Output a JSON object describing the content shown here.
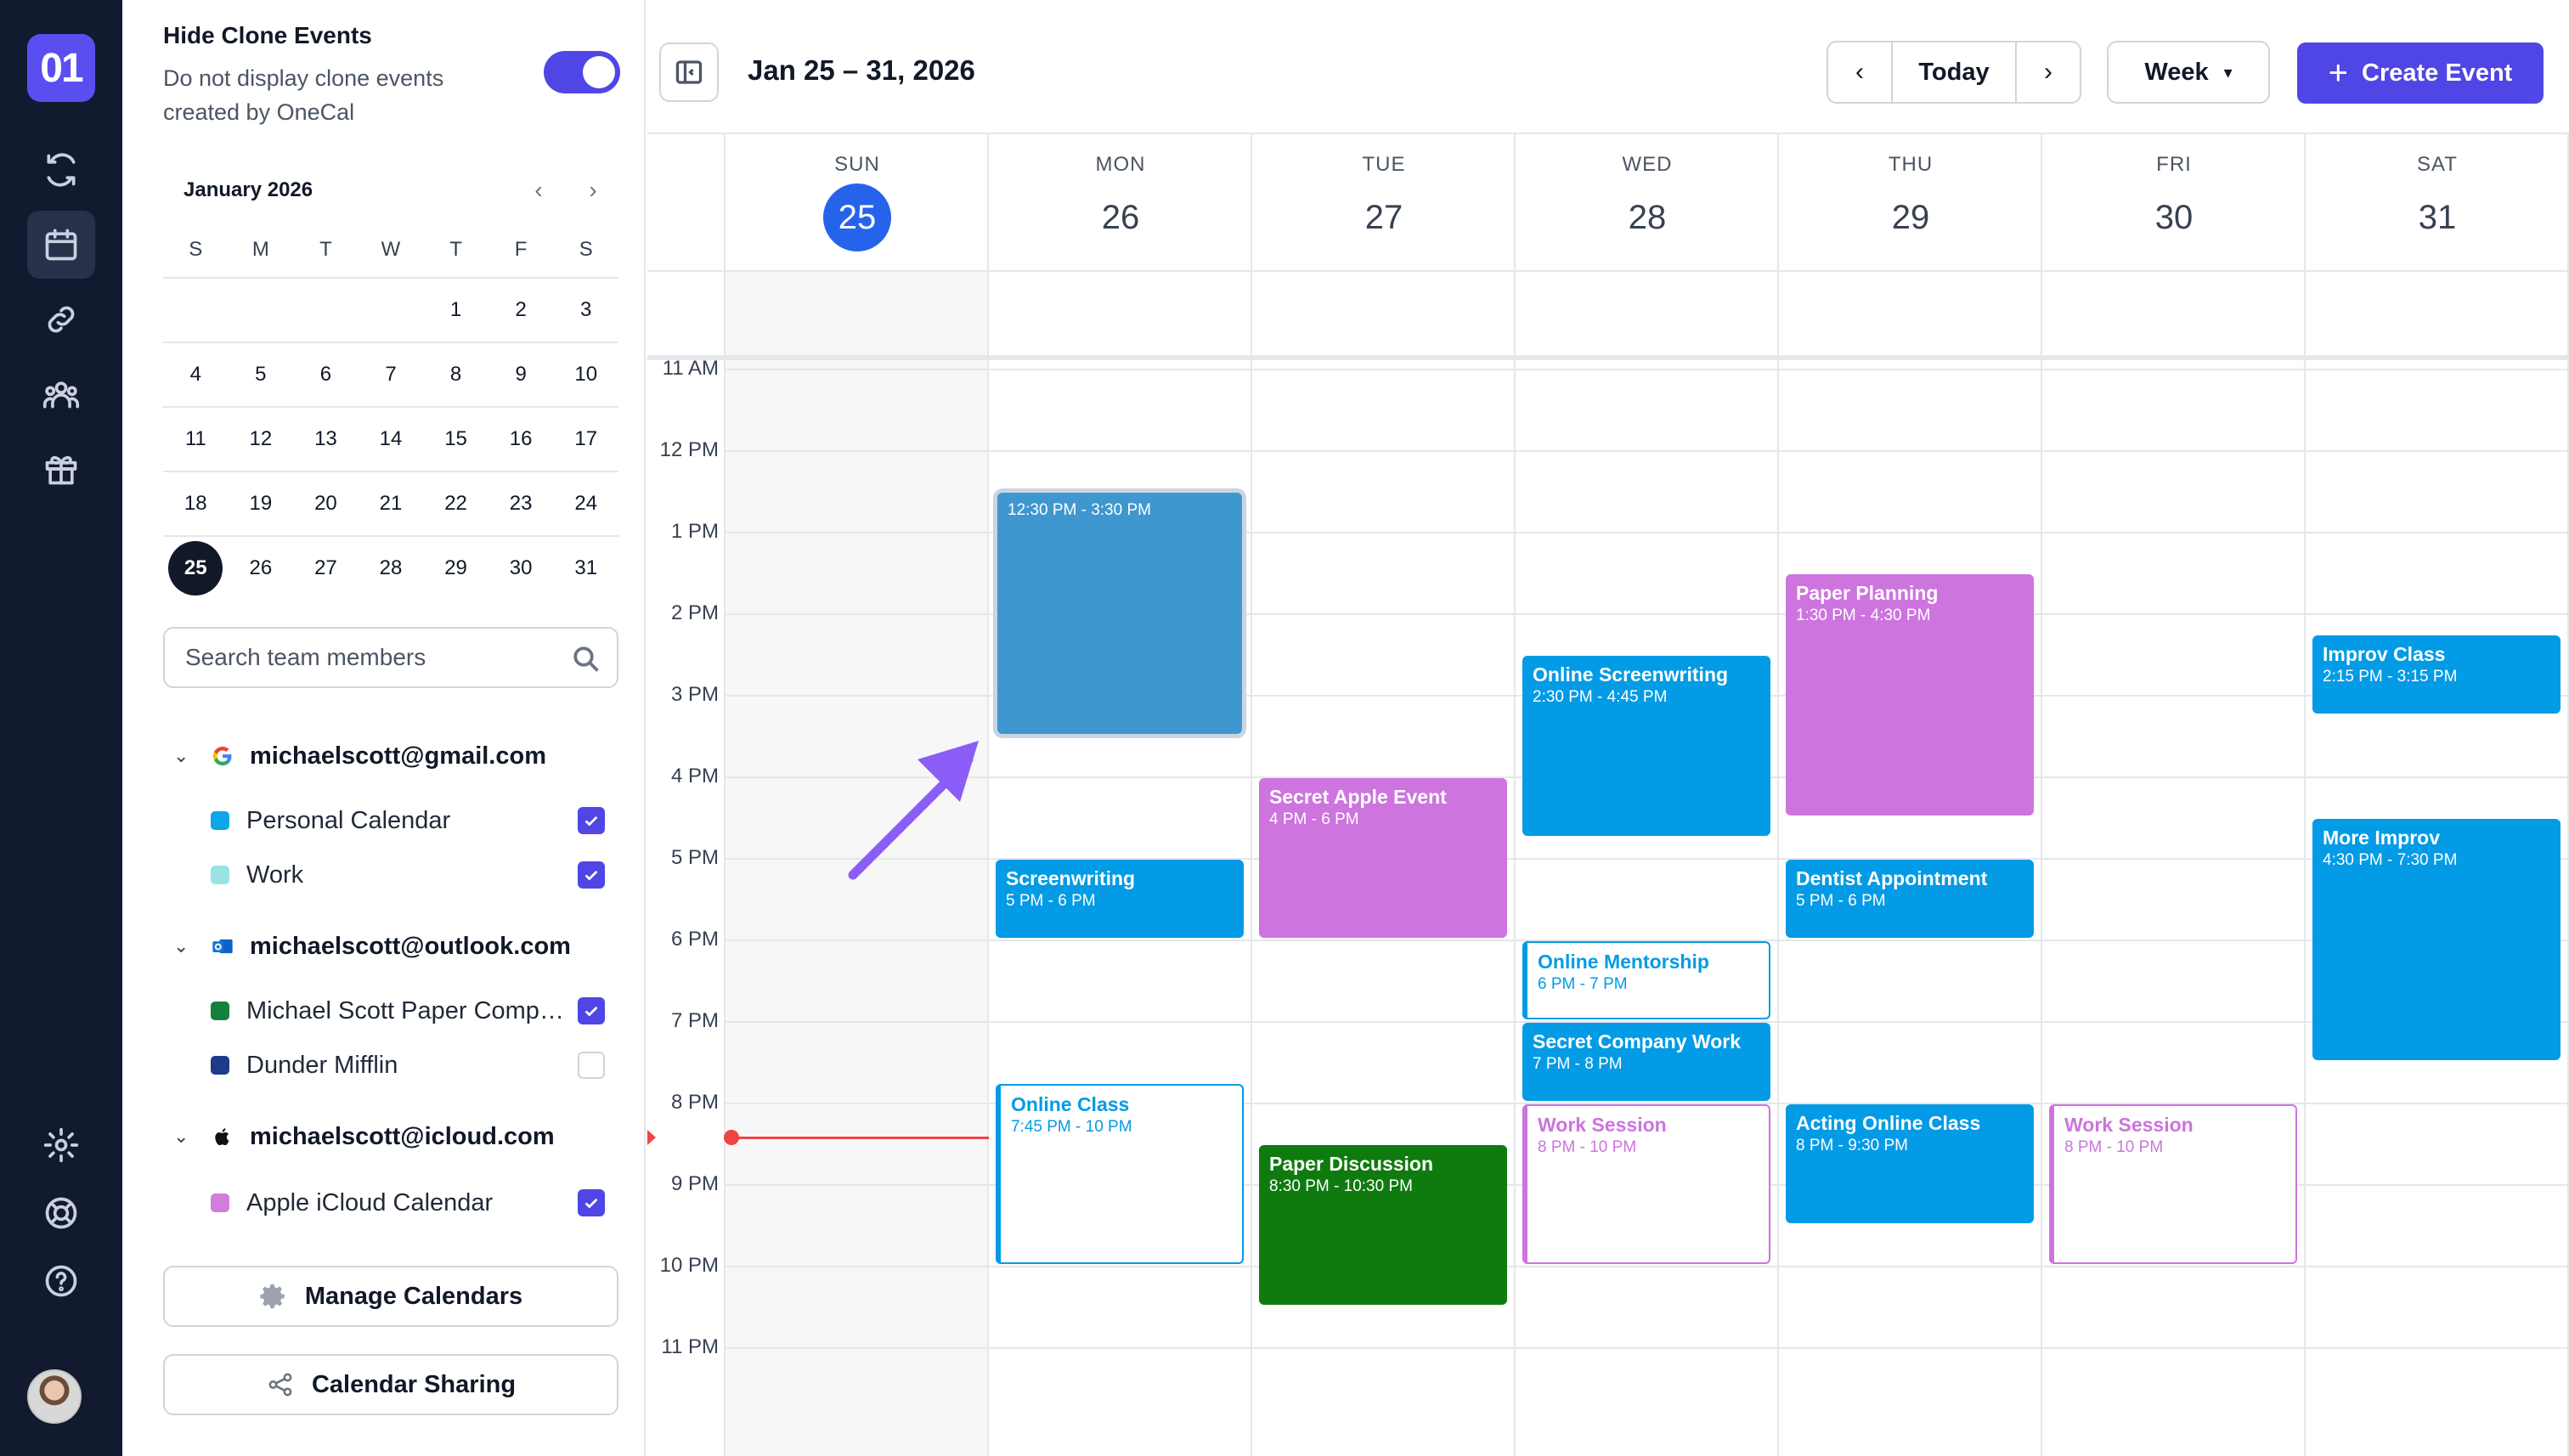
{
  "app": {
    "logo_text": "01"
  },
  "clone": {
    "title": "Hide Clone Events",
    "description": "Do not display clone events created by OneCal",
    "enabled": true
  },
  "mini_calendar": {
    "month_label": "January 2026",
    "weekdays": [
      "S",
      "M",
      "T",
      "W",
      "T",
      "F",
      "S"
    ],
    "weeks": [
      [
        "",
        "",
        "",
        "",
        "1",
        "2",
        "3"
      ],
      [
        "4",
        "5",
        "6",
        "7",
        "8",
        "9",
        "10"
      ],
      [
        "11",
        "12",
        "13",
        "14",
        "15",
        "16",
        "17"
      ],
      [
        "18",
        "19",
        "20",
        "21",
        "22",
        "23",
        "24"
      ],
      [
        "25",
        "26",
        "27",
        "28",
        "29",
        "30",
        "31"
      ]
    ],
    "selected": "25"
  },
  "search": {
    "placeholder": "Search team members"
  },
  "accounts": [
    {
      "email": "michaelscott@gmail.com",
      "provider": "google-icon",
      "calendars": [
        {
          "name": "Personal Calendar",
          "color": "#0ea5e9",
          "checked": true
        },
        {
          "name": "Work",
          "color": "#99e3e3",
          "checked": true
        }
      ]
    },
    {
      "email": "michaelscott@outlook.com",
      "provider": "outlook-icon",
      "calendars": [
        {
          "name": "Michael Scott Paper Company",
          "color": "#15803d",
          "checked": true
        },
        {
          "name": "Dunder Mifflin",
          "color": "#1e3a8a",
          "checked": false
        }
      ]
    },
    {
      "email": "michaelscott@icloud.com",
      "provider": "apple-icon",
      "calendars": [
        {
          "name": "Apple iCloud Calendar",
          "color": "#d17ddb",
          "checked": true
        }
      ]
    }
  ],
  "buttons": {
    "manage": "Manage Calendars",
    "sharing": "Calendar Sharing"
  },
  "header": {
    "range": "Jan 25 – 31, 2026",
    "today": "Today",
    "view": "Week",
    "create": "Create Event"
  },
  "days": [
    {
      "dow": "SUN",
      "num": "25",
      "today": true
    },
    {
      "dow": "MON",
      "num": "26"
    },
    {
      "dow": "TUE",
      "num": "27"
    },
    {
      "dow": "WED",
      "num": "28"
    },
    {
      "dow": "THU",
      "num": "29"
    },
    {
      "dow": "FRI",
      "num": "30"
    },
    {
      "dow": "SAT",
      "num": "31"
    }
  ],
  "hours": [
    "11 AM",
    "12 PM",
    "1 PM",
    "2 PM",
    "3 PM",
    "4 PM",
    "5 PM",
    "6 PM",
    "7 PM",
    "8 PM",
    "9 PM",
    "10 PM",
    "11 PM"
  ],
  "first_hour": 11,
  "now_hour": 20.42,
  "events": [
    {
      "day": 1,
      "start": 12.5,
      "end": 15.5,
      "title": "",
      "time": "12:30 PM - 3:30 PM",
      "style": "selected",
      "color": "#3f97cf"
    },
    {
      "day": 1,
      "start": 17,
      "end": 18,
      "title": "Screenwriting",
      "time": "5 PM - 6 PM",
      "style": "solid",
      "color": "#039be5"
    },
    {
      "day": 1,
      "start": 19.75,
      "end": 22,
      "title": "Online Class",
      "time": "7:45 PM - 10 PM",
      "style": "outline",
      "color": "#039be5"
    },
    {
      "day": 2,
      "start": 16,
      "end": 18,
      "title": "Secret Apple Event",
      "time": "4 PM - 6 PM",
      "style": "solid",
      "color": "#cd74de"
    },
    {
      "day": 2,
      "start": 20.5,
      "end": 22.5,
      "title": "Paper Discussion",
      "time": "8:30 PM - 10:30 PM",
      "style": "solid",
      "color": "#0f7b0f"
    },
    {
      "day": 3,
      "start": 14.5,
      "end": 16.75,
      "title": "Online Screenwriting",
      "time": "2:30 PM - 4:45 PM",
      "style": "solid",
      "color": "#039be5"
    },
    {
      "day": 3,
      "start": 18,
      "end": 19,
      "title": "Online Mentorship",
      "time": "6 PM - 7 PM",
      "style": "outline",
      "color": "#039be5"
    },
    {
      "day": 3,
      "start": 19,
      "end": 20,
      "title": "Secret Company Work",
      "time": "7 PM - 8 PM",
      "style": "solid",
      "color": "#039be5"
    },
    {
      "day": 3,
      "start": 20,
      "end": 22,
      "title": "Work Session",
      "time": "8 PM - 10 PM",
      "style": "outline",
      "color": "#cd74de"
    },
    {
      "day": 4,
      "start": 13.5,
      "end": 16.5,
      "title": "Paper Planning",
      "time": "1:30 PM - 4:30 PM",
      "style": "solid",
      "color": "#cd74de"
    },
    {
      "day": 4,
      "start": 17,
      "end": 18,
      "title": "Dentist Appointment",
      "time": "5 PM - 6 PM",
      "style": "solid",
      "color": "#039be5"
    },
    {
      "day": 4,
      "start": 20,
      "end": 21.5,
      "title": "Acting Online Class",
      "time": "8 PM - 9:30 PM",
      "style": "solid",
      "color": "#039be5"
    },
    {
      "day": 5,
      "start": 20,
      "end": 22,
      "title": "Work Session",
      "time": "8 PM - 10 PM",
      "style": "outline",
      "color": "#cd74de"
    },
    {
      "day": 6,
      "start": 14.25,
      "end": 15.25,
      "title": "Improv Class",
      "time": "2:15 PM - 3:15 PM",
      "style": "solid",
      "color": "#039be5"
    },
    {
      "day": 6,
      "start": 16.5,
      "end": 19.5,
      "title": "More Improv",
      "time": "4:30 PM - 7:30 PM",
      "style": "solid",
      "color": "#039be5"
    }
  ],
  "colors": {
    "accent": "#4f46e5",
    "today": "#2563eb",
    "now": "#ef4444",
    "arrow": "#8b5cf6"
  }
}
